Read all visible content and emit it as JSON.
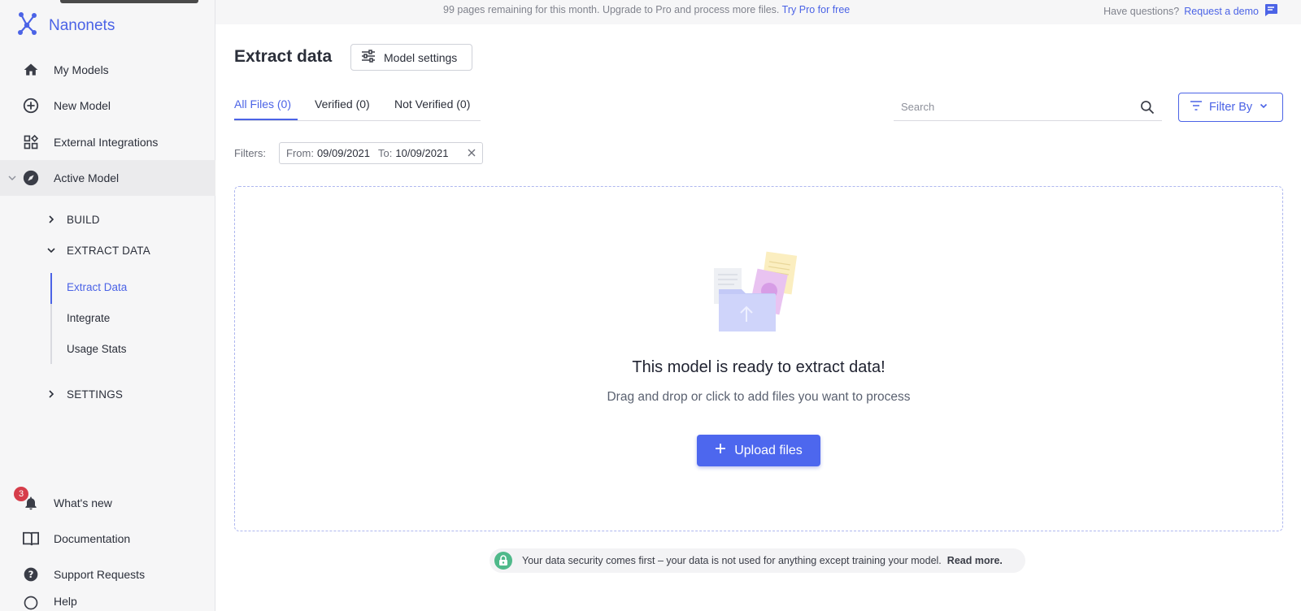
{
  "banner": {
    "message": "99 pages remaining for this month. Upgrade to Pro and process more files.",
    "cta": "Try Pro for free",
    "question": "Have questions?",
    "demo_link": "Request a demo"
  },
  "sidebar": {
    "brand": "Nanonets",
    "items": [
      {
        "label": "My Models",
        "icon": "home-icon"
      },
      {
        "label": "New Model",
        "icon": "plus-circle-icon"
      },
      {
        "label": "External Integrations",
        "icon": "integrations-icon"
      },
      {
        "label": "Active Model",
        "icon": "compass-icon"
      }
    ],
    "sections": {
      "build": "BUILD",
      "extract_data": "EXTRACT DATA",
      "settings": "SETTINGS"
    },
    "extract_children": [
      "Extract Data",
      "Integrate",
      "Usage Stats"
    ],
    "bottom_items": [
      {
        "label": "What's new",
        "icon": "bell-icon",
        "badge": "3"
      },
      {
        "label": "Documentation",
        "icon": "book-icon"
      },
      {
        "label": "Support Requests",
        "icon": "help-circle-icon"
      },
      {
        "label": "Help",
        "icon": "help-icon"
      }
    ]
  },
  "main": {
    "title": "Extract data",
    "model_settings_label": "Model settings",
    "tabs": [
      {
        "label": "All Files (0)",
        "active": true
      },
      {
        "label": "Verified (0)",
        "active": false
      },
      {
        "label": "Not Verified (0)",
        "active": false
      }
    ],
    "search_placeholder": "Search",
    "filter_by_label": "Filter By",
    "filters_label": "Filters:",
    "filter_chip": {
      "from_label": "From:",
      "from_value": "09/09/2021",
      "to_label": "To:",
      "to_value": "10/09/2021"
    },
    "dropzone": {
      "title": "This model is ready to extract data!",
      "subtitle": "Drag and drop or click to add files you want to process",
      "upload_label": "Upload files"
    },
    "security": {
      "message": "Your data security comes first – your data is not used for anything except training your model.",
      "read_more": "Read more."
    }
  },
  "colors": {
    "accent": "#4b63e6",
    "badge": "#d63d4a",
    "lock": "#4fb98a"
  }
}
